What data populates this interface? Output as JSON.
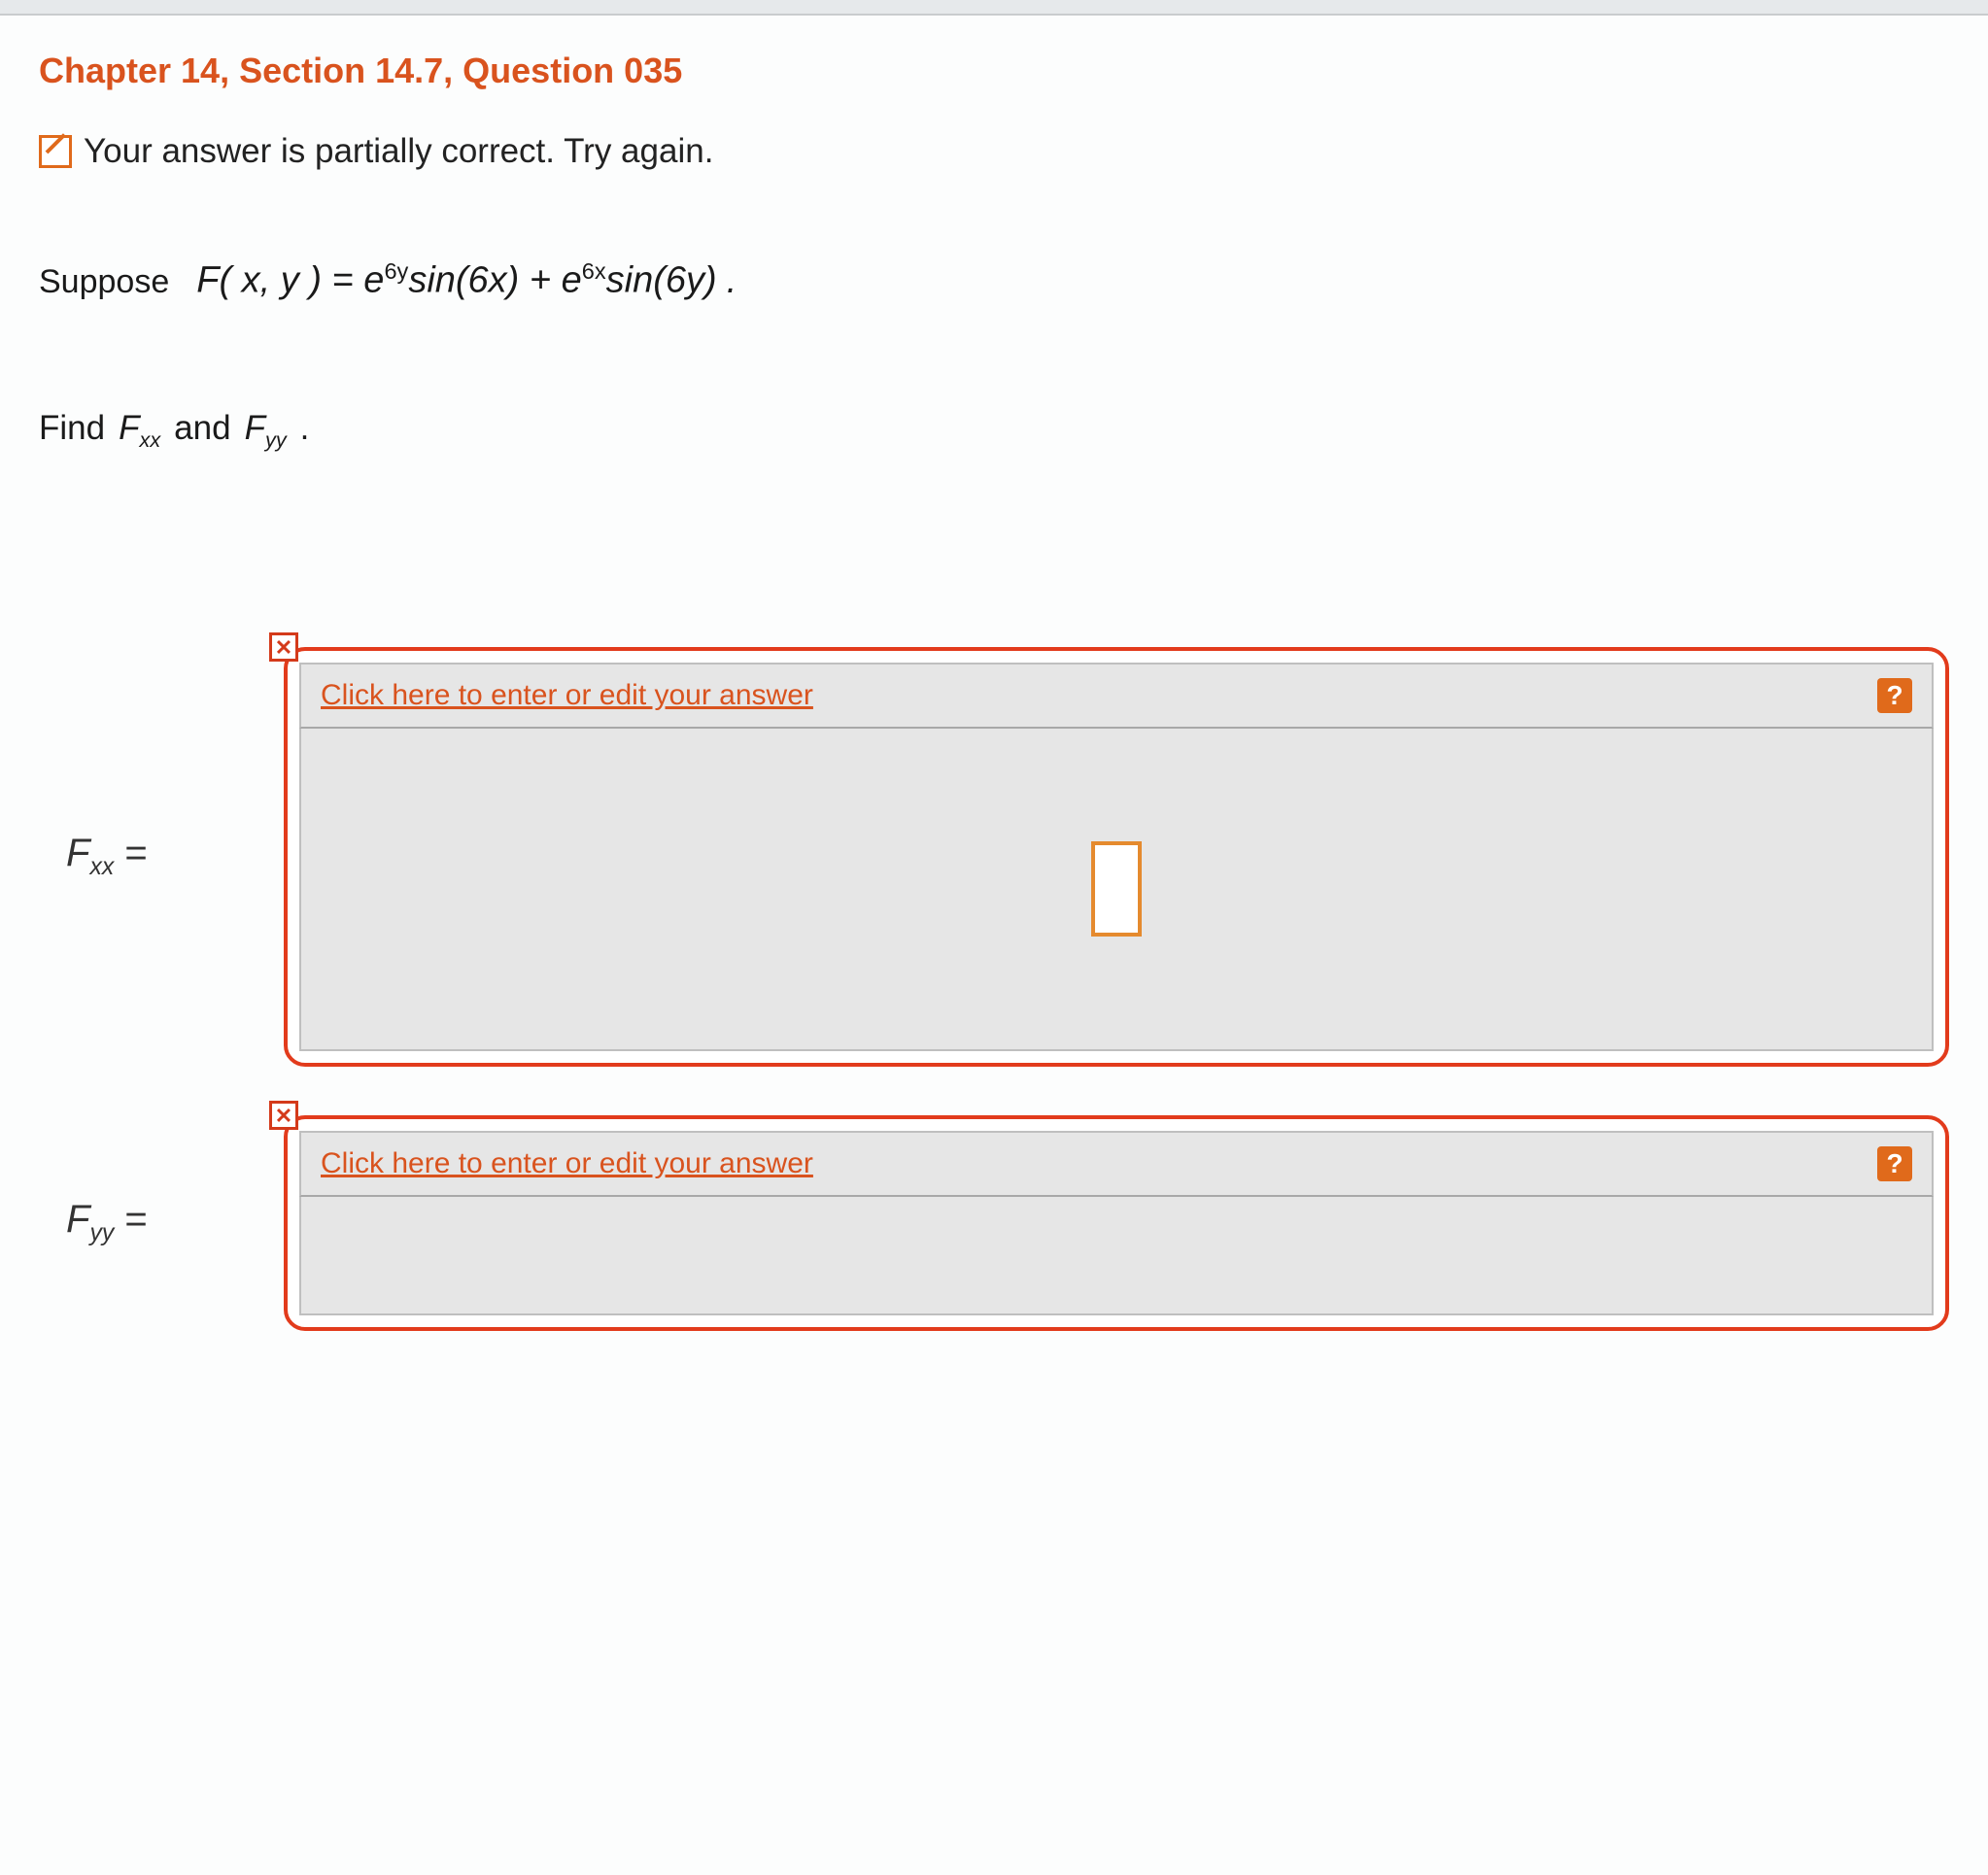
{
  "heading": "Chapter 14, Section 14.7, Question 035",
  "status": {
    "icon": "partial-correct-icon",
    "text": "Your answer is partially correct.  Try again."
  },
  "problem": {
    "lead": "Suppose",
    "func_left": "F( x, y ) = e",
    "exp1": "6y",
    "mid1": "sin(6x) + e",
    "exp2": "6x",
    "mid2": "sin(6y)",
    "tail": "."
  },
  "find": {
    "lead": "Find",
    "sym1_base": "F",
    "sym1_sub": "xx",
    "conj": "and",
    "sym2_base": "F",
    "sym2_sub": "yy",
    "tail": "."
  },
  "answers": [
    {
      "label_base": "F",
      "label_sub": "xx",
      "label_eq": " =",
      "link": "Click here to enter or edit your answer",
      "help": "?",
      "close": "✕",
      "show_cursor": true,
      "body_class": ""
    },
    {
      "label_base": "F",
      "label_sub": "yy",
      "label_eq": " =",
      "link": "Click here to enter or edit your answer",
      "help": "?",
      "close": "✕",
      "show_cursor": false,
      "body_class": "short"
    }
  ]
}
